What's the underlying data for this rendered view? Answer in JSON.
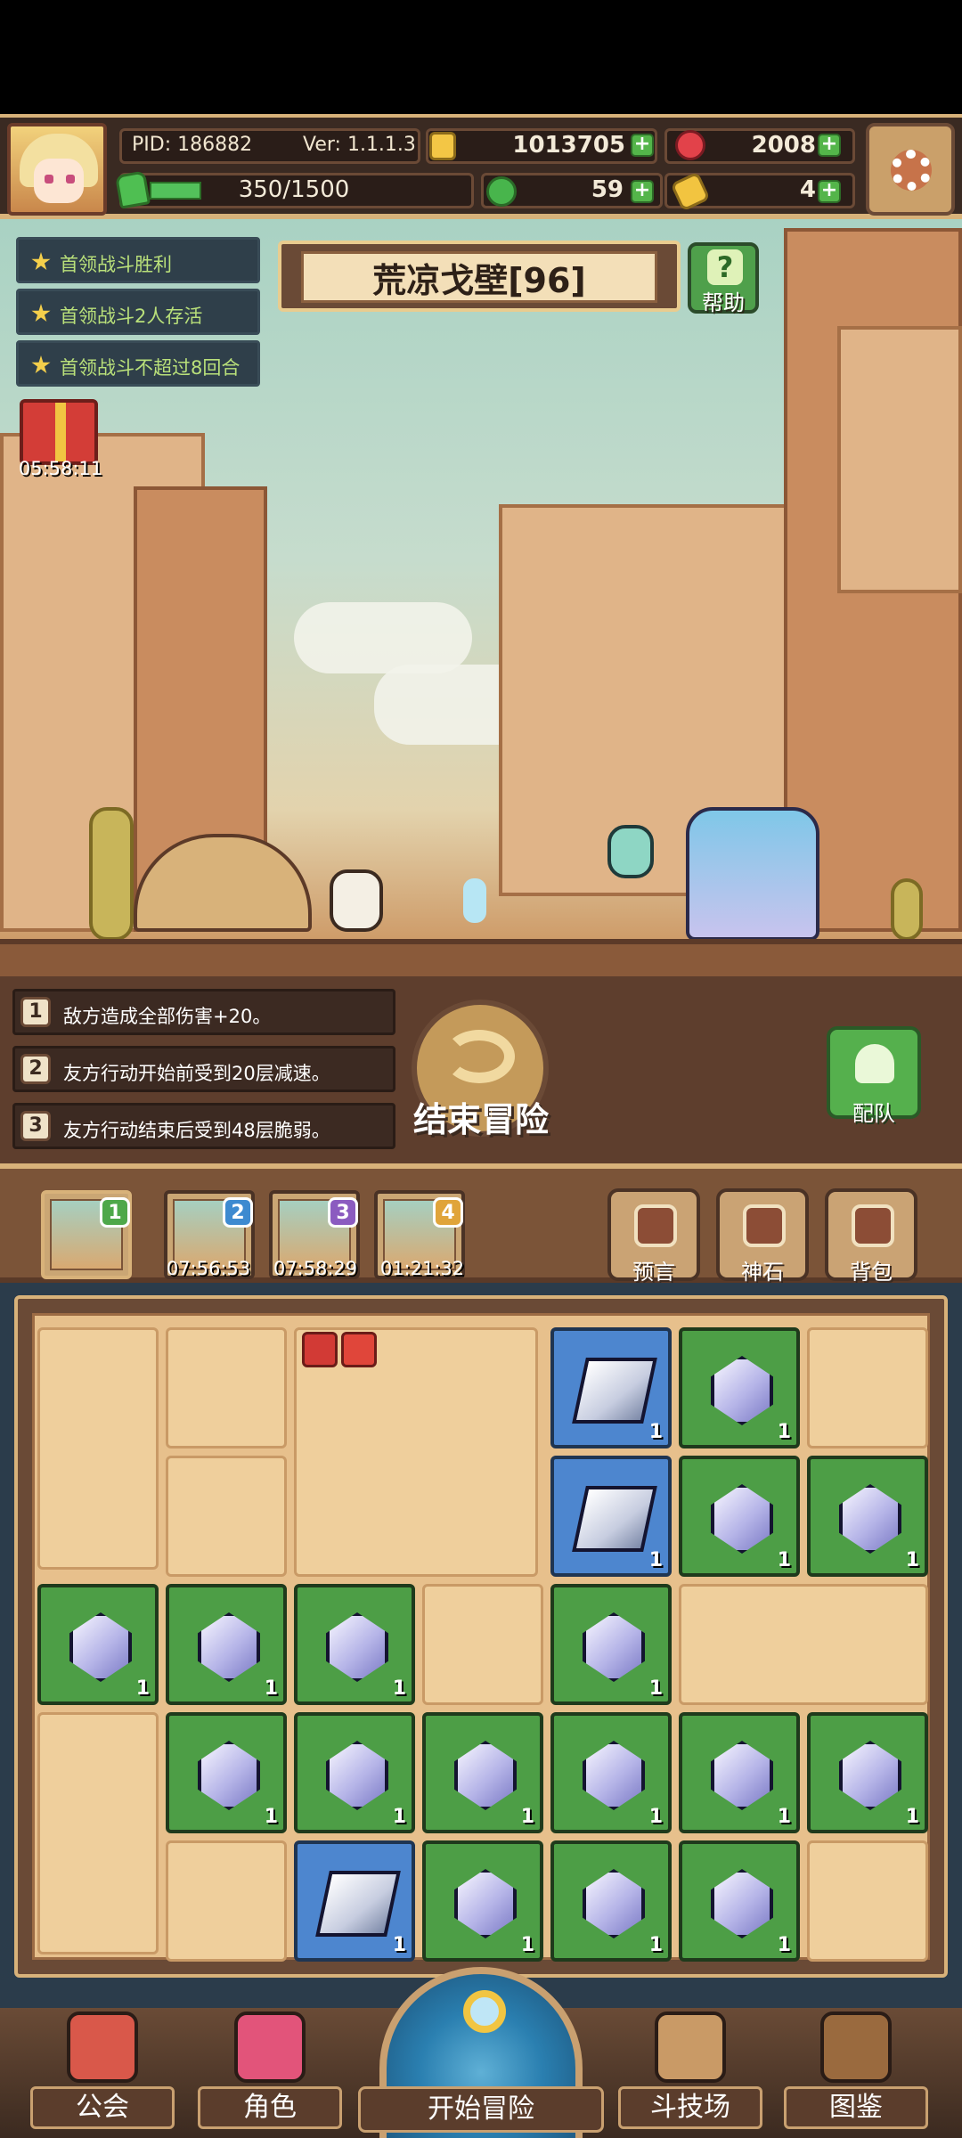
{
  "player": {
    "pid_label": "PID: 186882",
    "version_label": "Ver: 1.1.1.3",
    "gold": "1013705",
    "gems": "2008",
    "energy_text": "350/1500",
    "energy_fraction": 0.233,
    "clovers": "59",
    "keys": "4"
  },
  "stage": {
    "name": "荒凉戈壁[96]",
    "help_label": "帮助"
  },
  "objectives": [
    "首领战斗胜利",
    "首领战斗2人存活",
    "首领战斗不超过8回合"
  ],
  "gift": {
    "timer": "05:58:11"
  },
  "modifiers": [
    {
      "num": "1",
      "text": "敌方造成全部伤害+20。"
    },
    {
      "num": "2",
      "text": "友方行动开始前受到20层减速。"
    },
    {
      "num": "3",
      "text": "友方行动结束后受到48层脆弱。"
    }
  ],
  "actions": {
    "end_adventure": "结束冒险",
    "team": "配队"
  },
  "slots": [
    {
      "badge": "1",
      "timer": ""
    },
    {
      "badge": "2",
      "timer": "07:56:53"
    },
    {
      "badge": "3",
      "timer": "07:58:29"
    },
    {
      "badge": "4",
      "timer": "01:21:32"
    }
  ],
  "tools": [
    {
      "label": "预言",
      "icon": "crystal-ball-icon"
    },
    {
      "label": "神石",
      "icon": "stone-icon"
    },
    {
      "label": "背包",
      "icon": "backpack-icon"
    }
  ],
  "inventory_qty": "1",
  "nav": {
    "guild": "公会",
    "character": "角色",
    "start": "开始冒险",
    "arena": "斗技场",
    "codex": "图鉴"
  },
  "colors": {
    "accent_gold": "#d8b27a",
    "green_tile": "#4d9e46",
    "blue_tile": "#4d86cf",
    "objective_text": "#b9e07a"
  }
}
